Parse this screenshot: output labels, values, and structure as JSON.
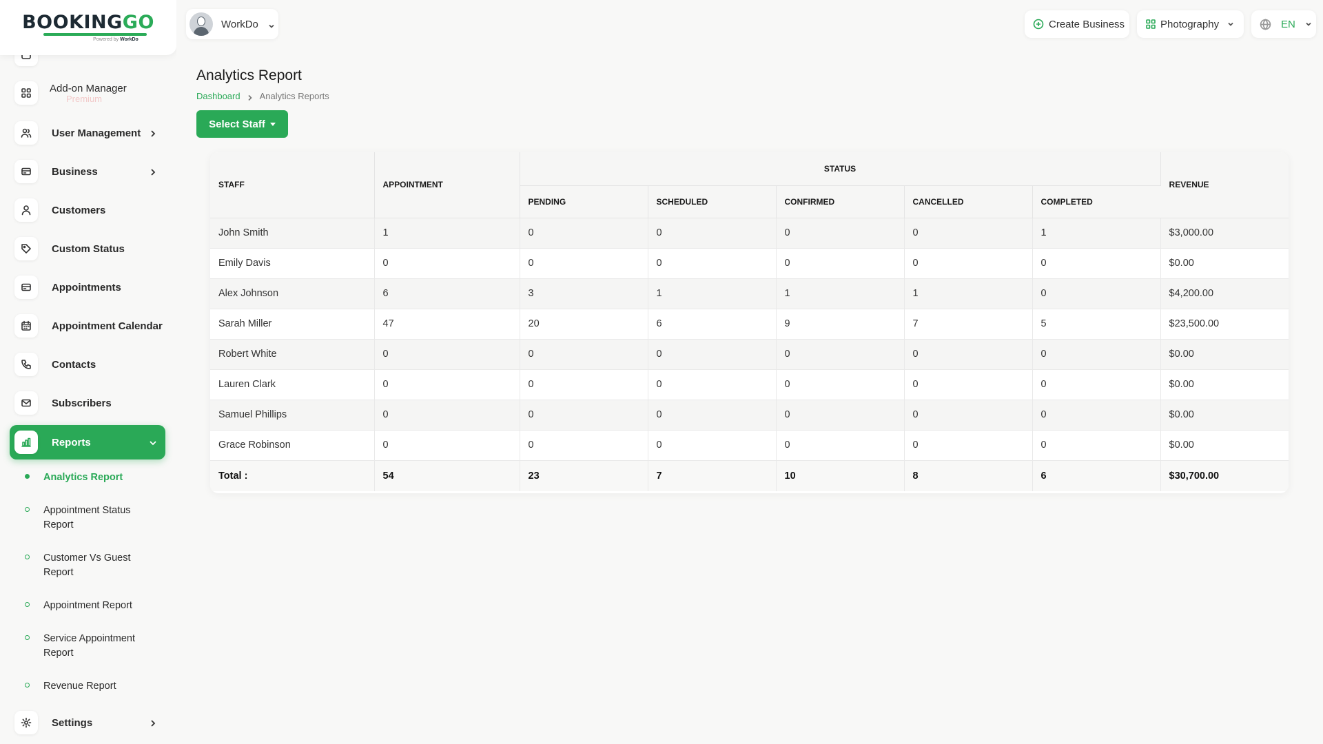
{
  "brand": {
    "logo_main": "BOOKING",
    "logo_accent": "GO",
    "logo_sub_prefix": "Powered by",
    "logo_sub_brand": "WorkDo"
  },
  "header": {
    "user_name": "WorkDo",
    "create_business": "Create Business",
    "workspace": "Photography",
    "language": "EN"
  },
  "sidebar": {
    "premium_label": "Premium",
    "items": [
      {
        "label": "Add-on Manager",
        "icon": "grid-icon"
      },
      {
        "label": "User Management",
        "icon": "users-icon"
      },
      {
        "label": "Business",
        "icon": "card-icon"
      },
      {
        "label": "Customers",
        "icon": "user-icon"
      },
      {
        "label": "Custom Status",
        "icon": "tag-icon"
      },
      {
        "label": "Appointments",
        "icon": "card-icon"
      },
      {
        "label": "Appointment Calendar",
        "icon": "calendar-icon"
      },
      {
        "label": "Contacts",
        "icon": "phone-icon"
      },
      {
        "label": "Subscribers",
        "icon": "mail-icon"
      },
      {
        "label": "Reports",
        "icon": "chart-icon"
      },
      {
        "label": "Settings",
        "icon": "gear-icon"
      }
    ],
    "report_items": [
      "Analytics Report",
      "Appointment Status Report",
      "Customer Vs Guest Report",
      "Appointment Report",
      "Service Appointment Report",
      "Revenue Report"
    ]
  },
  "page": {
    "title": "Analytics Report",
    "breadcrumb_home": "Dashboard",
    "breadcrumb_current": "Analytics Reports",
    "select_staff": "Select Staff"
  },
  "table": {
    "headers": {
      "staff": "STAFF",
      "appointment": "APPOINTMENT",
      "status": "STATUS",
      "pending": "PENDING",
      "scheduled": "SCHEDULED",
      "confirmed": "CONFIRMED",
      "cancelled": "CANCELLED",
      "completed": "COMPLETED",
      "revenue": "REVENUE"
    },
    "rows": [
      [
        "John Smith",
        "1",
        "0",
        "0",
        "0",
        "0",
        "1",
        "$3,000.00"
      ],
      [
        "Emily Davis",
        "0",
        "0",
        "0",
        "0",
        "0",
        "0",
        "$0.00"
      ],
      [
        "Alex Johnson",
        "6",
        "3",
        "1",
        "1",
        "1",
        "0",
        "$4,200.00"
      ],
      [
        "Sarah Miller",
        "47",
        "20",
        "6",
        "9",
        "7",
        "5",
        "$23,500.00"
      ],
      [
        "Robert White",
        "0",
        "0",
        "0",
        "0",
        "0",
        "0",
        "$0.00"
      ],
      [
        "Lauren Clark",
        "0",
        "0",
        "0",
        "0",
        "0",
        "0",
        "$0.00"
      ],
      [
        "Samuel Phillips",
        "0",
        "0",
        "0",
        "0",
        "0",
        "0",
        "$0.00"
      ],
      [
        "Grace Robinson",
        "0",
        "0",
        "0",
        "0",
        "0",
        "0",
        "$0.00"
      ]
    ],
    "total": [
      "Total :",
      "54",
      "23",
      "7",
      "10",
      "8",
      "6",
      "$30,700.00"
    ]
  }
}
